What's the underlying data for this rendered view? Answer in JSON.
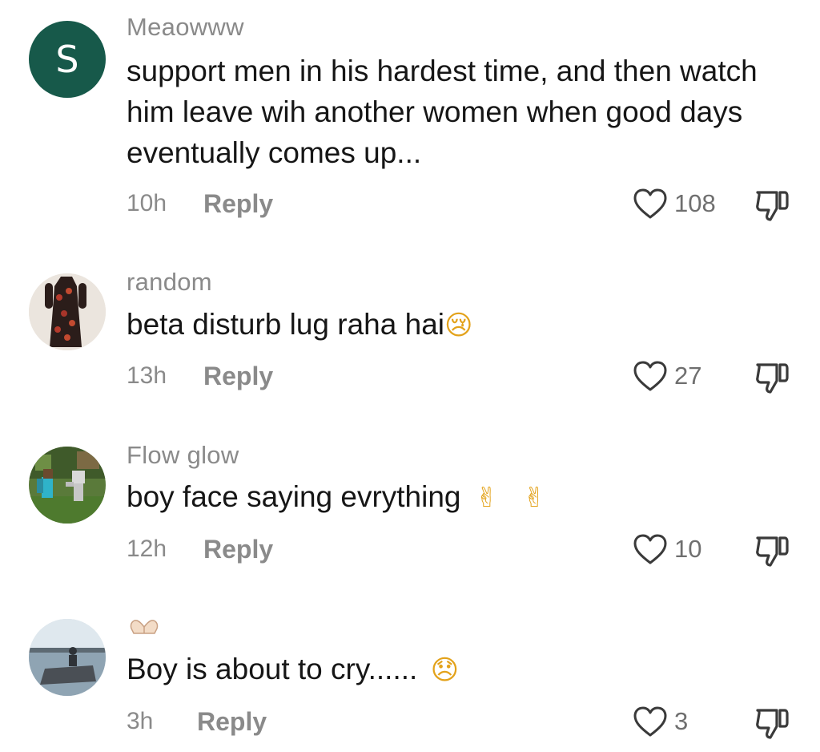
{
  "comments": [
    {
      "avatar_letter": "S",
      "username": "Meaowww",
      "text": "support men in his hardest time, and then watch him leave wih another women when good days eventually comes up...",
      "time": "10h",
      "reply_label": "Reply",
      "likes": "108"
    },
    {
      "username": "random",
      "text": "beta disturb lug raha hai",
      "emoji": "😢",
      "time": "13h",
      "reply_label": "Reply",
      "likes": "27"
    },
    {
      "username": "Flow glow",
      "text": "boy face saying evrything ",
      "emoji": "✌ ✌",
      "time": "12h",
      "reply_label": "Reply",
      "likes": "10"
    },
    {
      "username": "",
      "text": "Boy is about to cry...... ",
      "emoji": "😞",
      "time": "3h",
      "reply_label": "Reply",
      "likes": "3"
    }
  ],
  "colors": {
    "avatar_s": "#17594a",
    "muted_text": "#8a8a8a",
    "body_text": "#161616"
  },
  "icons": {
    "like": "heart-outline-icon",
    "dislike": "thumbs-down-icon"
  }
}
